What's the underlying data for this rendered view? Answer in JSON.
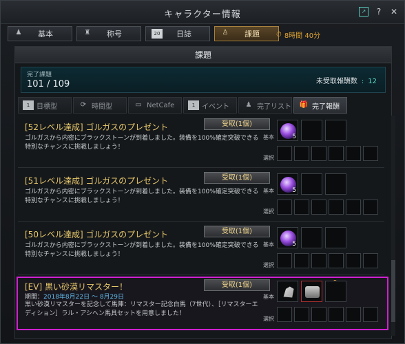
{
  "window": {
    "title": "キャラクター情報"
  },
  "top_tabs": [
    {
      "label": "基本",
      "icon": "person-icon"
    },
    {
      "label": "称号",
      "icon": "title-icon"
    },
    {
      "label": "日誌",
      "icon": "calendar-icon",
      "icon_text": "20"
    },
    {
      "label": "課題",
      "icon": "quest-icon",
      "active": true
    }
  ],
  "timer": "8時間 40分",
  "panel": {
    "header": "課題",
    "summary": {
      "completed_label": "完了課題",
      "completed_value": "101 / 109",
      "unreceived_label": "未受取報酬数",
      "unreceived_value": "12"
    }
  },
  "sub_tabs": [
    {
      "label": "目標型",
      "icon": "calendar-icon",
      "icon_text": "1"
    },
    {
      "label": "時間型",
      "icon": "refresh-icon"
    },
    {
      "label": "NetCafe",
      "icon": "monitor-icon"
    },
    {
      "label": "イベント",
      "icon": "calendar-icon",
      "icon_text": "1"
    },
    {
      "label": "完了リスト",
      "icon": "person-icon"
    },
    {
      "label": "完了報酬",
      "icon": "gift-icon",
      "active": true
    }
  ],
  "quests": [
    {
      "title": "[52レベル達成] ゴルガスのプレゼント",
      "desc": "ゴルガスから内密にブラックストーンが到着しました。装備を100%確定突破できる特別なチャンスに挑戦しましょう！",
      "button": "受取(1個)",
      "base_label": "基本",
      "select_label": "選択",
      "count": "5"
    },
    {
      "title": "[51レベル達成] ゴルガスのプレゼント",
      "desc": "ゴルガスから内密にブラックストーンが到着しました。装備を100%確定突破できる特別なチャンスに挑戦しましょう！",
      "button": "受取(1個)",
      "base_label": "基本",
      "select_label": "選択",
      "count": "5"
    },
    {
      "title": "[50レベル達成] ゴルガスのプレゼント",
      "desc": "ゴルガスから内密にブラックストーンが到着しました。装備を100%確定突破できる特別なチャンスに挑戦しましょう！",
      "button": "受取(1個)",
      "base_label": "基本",
      "select_label": "選択",
      "count": "5"
    },
    {
      "title": "[EV] 黒い砂漠リマスター！",
      "period_label": "期間：",
      "period": "2018年8月22日 ～ 8月29日",
      "desc": "黒い砂漠リマスターを記念して馬陣：リマスター記念白馬（7世代）、［リマスターエディション］ラル・アシヘン馬具セットを用意しました！",
      "button": "受取(1個)",
      "base_label": "基本",
      "select_label": "選択",
      "p_mark": "P"
    }
  ]
}
